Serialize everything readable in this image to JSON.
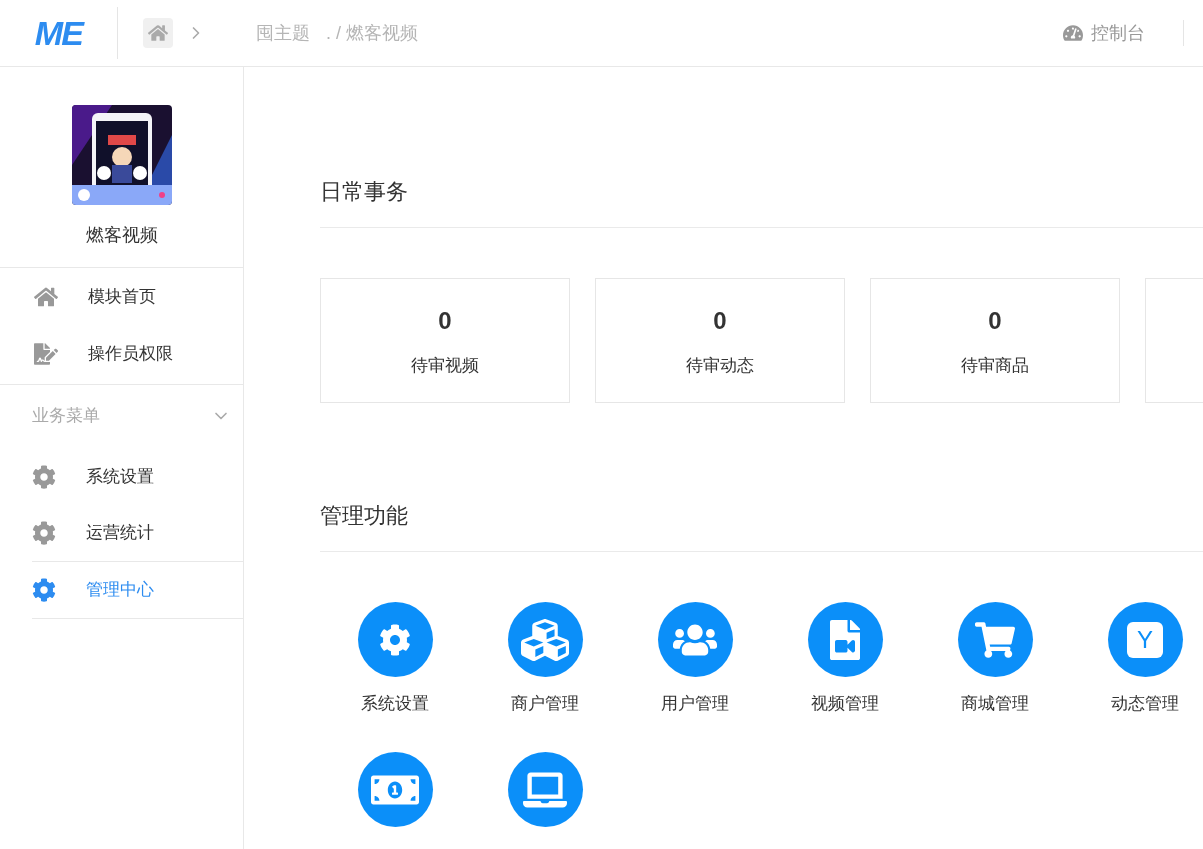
{
  "header": {
    "logo": "ME",
    "breadcrumb": [
      "囤主题",
      ". / 燃客视频"
    ],
    "console": "控制台"
  },
  "sidebar": {
    "app_name": "燃客视频",
    "top_items": [
      {
        "label": "模块首页",
        "selected": false
      },
      {
        "label": "操作员权限",
        "selected": false
      }
    ],
    "section": {
      "title": "业务菜单",
      "expanded": true
    },
    "items": [
      {
        "label": "系统设置",
        "selected": false
      },
      {
        "label": "运营统计",
        "selected": false
      },
      {
        "label": "管理中心",
        "selected": true
      }
    ]
  },
  "daily": {
    "title": "日常事务",
    "cards": [
      {
        "count": "0",
        "label": "待审视频"
      },
      {
        "count": "0",
        "label": "待审动态"
      },
      {
        "count": "0",
        "label": "待审商品"
      }
    ]
  },
  "manage": {
    "title": "管理功能",
    "tiles": [
      {
        "label": "系统设置"
      },
      {
        "label": "商户管理"
      },
      {
        "label": "用户管理"
      },
      {
        "label": "视频管理"
      },
      {
        "label": "商城管理"
      },
      {
        "glyph": "Y",
        "label": "动态管理"
      }
    ]
  }
}
